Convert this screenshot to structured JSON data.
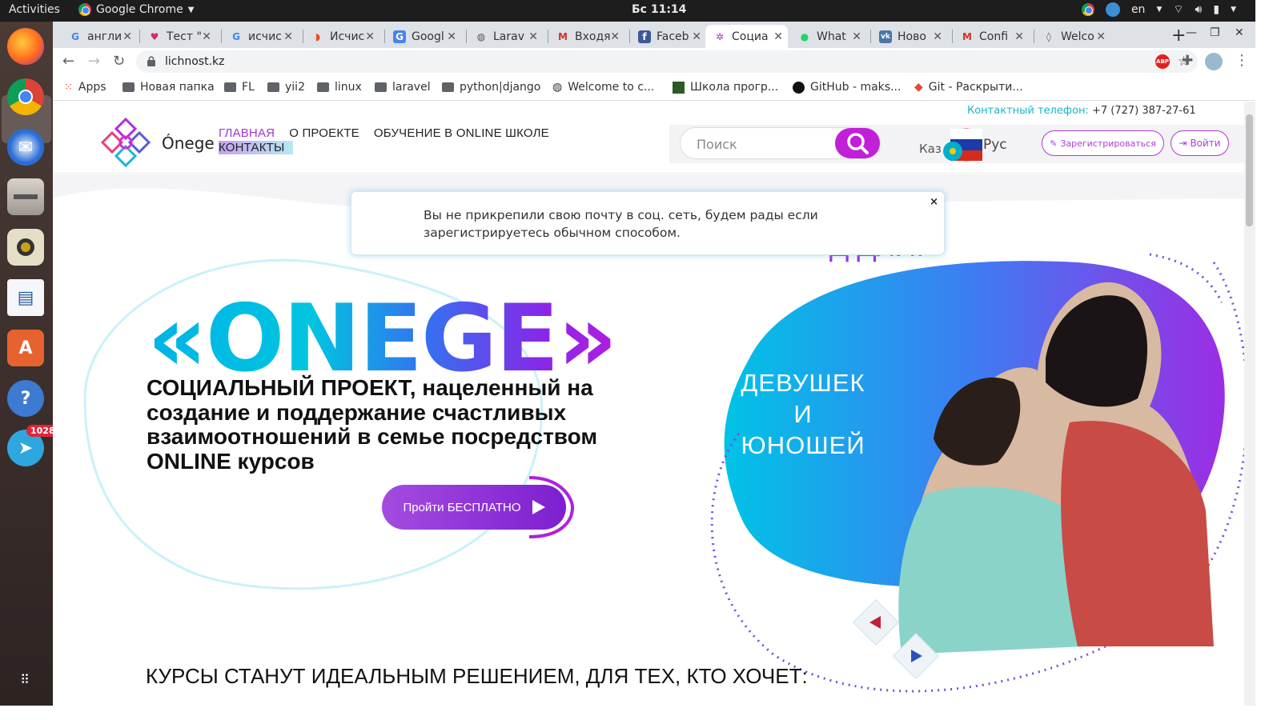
{
  "system": {
    "activities": "Activities",
    "app_name": "Google Chrome",
    "clock": "Бс 11:14",
    "lang": "en",
    "telegram_badge": "1028"
  },
  "tabs": [
    {
      "title": "англи",
      "icon": "google-icon"
    },
    {
      "title": "Тест \"",
      "icon": "heart-icon"
    },
    {
      "title": "исчис",
      "icon": "google-icon"
    },
    {
      "title": "Исчис",
      "icon": "wifi-icon"
    },
    {
      "title": "Googl",
      "icon": "translate-icon"
    },
    {
      "title": "Larav",
      "icon": "globe-icon"
    },
    {
      "title": "Входя",
      "icon": "gmail-icon"
    },
    {
      "title": "Faceb",
      "icon": "facebook-icon"
    },
    {
      "title": "Социа",
      "icon": "onege-icon"
    },
    {
      "title": "What",
      "icon": "whatsapp-icon"
    },
    {
      "title": "Ново",
      "icon": "vk-icon"
    },
    {
      "title": "Confi",
      "icon": "gmail-icon"
    },
    {
      "title": "Welco",
      "icon": "drop-icon"
    }
  ],
  "omnibox": {
    "url": "lichnost.kz"
  },
  "bookmarks": [
    {
      "label": "Apps",
      "icon": "apps-grid-icon"
    },
    {
      "label": "Новая папка",
      "icon": "folder-icon"
    },
    {
      "label": "FL",
      "icon": "folder-icon"
    },
    {
      "label": "yii2",
      "icon": "folder-icon"
    },
    {
      "label": "linux",
      "icon": "folder-icon"
    },
    {
      "label": "laravel",
      "icon": "folder-icon"
    },
    {
      "label": "python|django",
      "icon": "folder-icon"
    },
    {
      "label": "Welcome to c...",
      "icon": "globe-icon"
    },
    {
      "label": "Школа прогр...",
      "icon": "acmp-icon"
    },
    {
      "label": "GitHub - maks...",
      "icon": "github-icon"
    },
    {
      "label": "Git - Раскрыти...",
      "icon": "git-icon"
    }
  ],
  "site": {
    "phone_label": "Контактный телефон:",
    "phone": "+7 (727) 387-27-61",
    "logo_text": "Ónege",
    "nav": {
      "home": "ГЛАВНАЯ",
      "about": "О ПРОЕКТЕ",
      "school": "ОБУЧЕНИЕ В ONLINE ШКОЛЕ",
      "contacts": "КОНТАКТЫ"
    },
    "search_placeholder": "Поиск",
    "lang_kz": "Каз",
    "lang_ru": "Рус",
    "register": "Зарегистрироваться",
    "login": "Войти",
    "toast_text": "Вы не прикрепили свою почту в соц. сеть, будем рады если зарегистрируетесь обычном способом.",
    "toast_close": "×",
    "brand": "«ONEGE»",
    "tagline": "СОЦИАЛЬНЫЙ ПРОЕКТ, нацеленный на создание и поддержание счастливых взаимоотношений в семье посредством ONLINE курсов",
    "cta": "Пройти БЕСПЛАТНО",
    "partial_title": "Д ДЛЯ:",
    "girls_line1": "ДЕВУШЕК",
    "girls_line2": "И",
    "girls_line3": "ЮНОШЕЙ",
    "section_heading": "КУРСЫ СТАНУТ ИДЕАЛЬНЫМ РЕШЕНИЕМ, ДЛЯ ТЕХ, КТО ХОЧЕТ:"
  }
}
